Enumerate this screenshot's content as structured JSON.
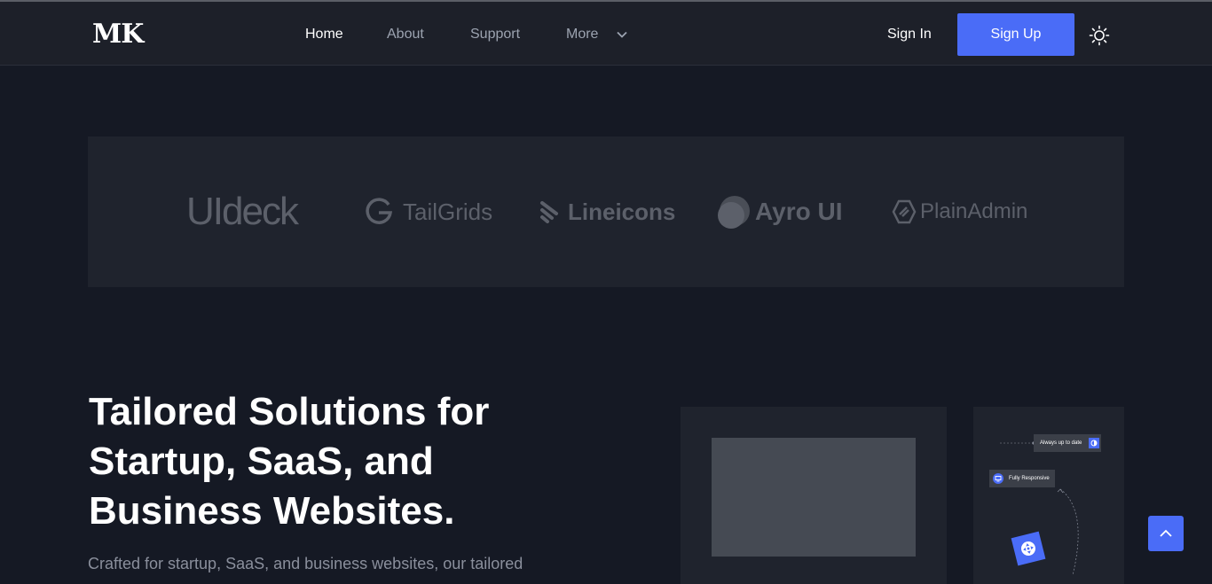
{
  "nav": {
    "logo": "MK",
    "links": [
      "Home",
      "About",
      "Support",
      "More"
    ],
    "sign_in": "Sign In",
    "sign_up": "Sign Up"
  },
  "brands": [
    "UIdeck",
    "TailGrids",
    "Lineicons",
    "Ayro UI",
    "PlainAdmin"
  ],
  "hero": {
    "title": "Tailored Solutions for Startup, SaaS, and Business Websites.",
    "subtitle": "Crafted for startup, SaaS, and business websites, our tailored"
  },
  "features": {
    "always_up_to_date": "Always up to date",
    "fully_responsive": "Fully Responsive"
  },
  "colors": {
    "accent": "#4a6cf7",
    "background": "#151924",
    "header": "#1d2029",
    "card": "#1f232d"
  },
  "icons": [
    "chevron-down-icon",
    "sun-icon",
    "contrast-icon",
    "monitor-icon",
    "move-icon",
    "arrow-up-icon"
  ]
}
